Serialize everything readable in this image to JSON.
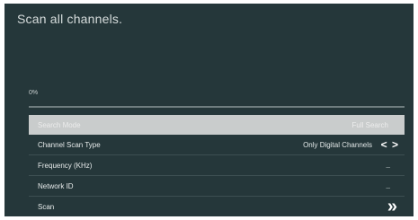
{
  "screen": {
    "title": "Scan all channels.",
    "progress": {
      "label": "0%",
      "value": 0
    }
  },
  "menu": {
    "selected_row": {
      "label": "Search Mode",
      "value": "Full Search"
    },
    "channel_scan_type": {
      "label": "Channel Scan Type",
      "value": "Only Digital Channels",
      "arrows": "< >"
    },
    "frequency": {
      "label": "Frequency (KHz)",
      "value": "_"
    },
    "network_id": {
      "label": "Network ID",
      "value": "_"
    },
    "scan": {
      "label": "Scan",
      "icon": "double-chevron-right-icon"
    }
  }
}
